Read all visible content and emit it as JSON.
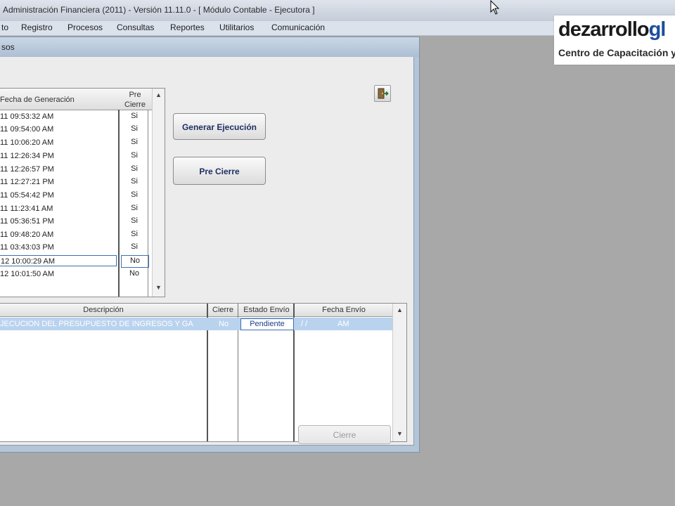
{
  "window_title": "Administración Financiera (2011) - Versión 11.11.0 - [ Módulo Contable - Ejecutora ]",
  "menu": [
    "to",
    "Registro",
    "Procesos",
    "Consultas",
    "Reportes",
    "Utilitarios",
    "Comunicación"
  ],
  "logo": {
    "brand_a": "dezarrollo",
    "brand_b": "gl",
    "tagline": "Centro de Capacitación y"
  },
  "dialog": {
    "title": "sos"
  },
  "top_grid": {
    "col_fecha": "Fecha de Generación",
    "col_precierre_1": "Pre",
    "col_precierre_2": "Cierre",
    "rows": [
      {
        "fecha": "11 09:53:32 AM",
        "pre": "Si"
      },
      {
        "fecha": "11 09:54:00 AM",
        "pre": "Si"
      },
      {
        "fecha": "11 10:06:20 AM",
        "pre": "Si"
      },
      {
        "fecha": "11 12:26:34 PM",
        "pre": "Si"
      },
      {
        "fecha": "11 12:26:57 PM",
        "pre": "Si"
      },
      {
        "fecha": "11 12:27:21 PM",
        "pre": "Si"
      },
      {
        "fecha": "11 05:54:42 PM",
        "pre": "Si"
      },
      {
        "fecha": "11 11:23:41 AM",
        "pre": "Si"
      },
      {
        "fecha": "11 05:36:51 PM",
        "pre": "Si"
      },
      {
        "fecha": "11 09:48:20 AM",
        "pre": "Si"
      },
      {
        "fecha": "11 03:43:03 PM",
        "pre": "Si"
      },
      {
        "fecha": "12 10:00:29 AM",
        "pre": "No"
      },
      {
        "fecha": "12 10:01:50 AM",
        "pre": "No"
      }
    ]
  },
  "buttons": {
    "generar": "Generar Ejecución",
    "precierre": "Pre Cierre",
    "cierre": "Cierre"
  },
  "bottom_grid": {
    "col_descripcion": "Descripción",
    "col_cierre": "Cierre",
    "col_estado": "Estado Envío",
    "col_fecha": "Fecha Envío",
    "rows": [
      {
        "descripcion": "JECUCION DEL PRESUPUESTO DE INGRESOS Y GA",
        "cierre": "No",
        "estado": "Pendiente",
        "fecha_1": "/ /",
        "fecha_2": "AM"
      }
    ]
  }
}
